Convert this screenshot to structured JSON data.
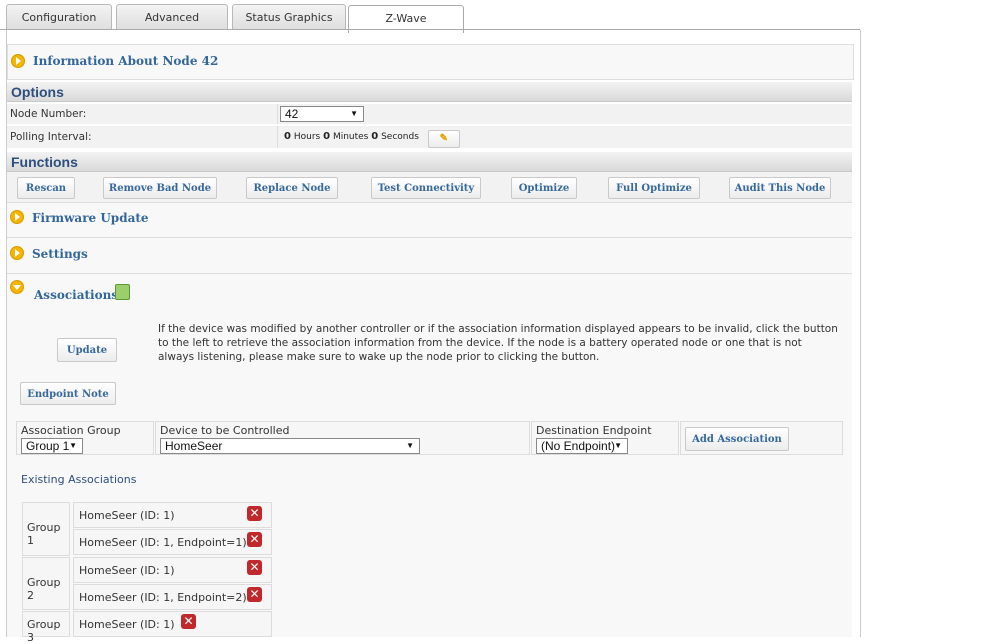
{
  "tabs": [
    {
      "label": "Configuration"
    },
    {
      "label": "Advanced"
    },
    {
      "label": "Status Graphics"
    },
    {
      "label": "Z-Wave"
    }
  ],
  "info": {
    "title": "Information About Node 42"
  },
  "options": {
    "header": "Options",
    "node_number_label": "Node Number:",
    "node_number_value": "42",
    "polling_label": "Polling Interval:",
    "polling": {
      "hours": "0",
      "hours_label": "Hours",
      "minutes": "0",
      "minutes_label": "Minutes",
      "seconds": "0",
      "seconds_label": "Seconds"
    }
  },
  "functions": {
    "header": "Functions",
    "buttons": [
      "Rescan",
      "Remove Bad Node",
      "Replace Node",
      "Test Connectivity",
      "Optimize",
      "Full Optimize",
      "Audit This Node"
    ]
  },
  "sections": {
    "firmware": "Firmware Update",
    "settings": "Settings",
    "associations": "Associations"
  },
  "associations": {
    "update_button": "Update",
    "description": "If the device was modified by another controller or if the association information displayed appears to be invalid, click the button to the left to retrieve the association information from the device. If the node is a battery operated node or one that is not always listening, please make sure to wake up the node prior to clicking the button.",
    "endpoint_note_button": "Endpoint Note",
    "group_label": "Association Group",
    "group_value": "Group 1",
    "device_label": "Device to be Controlled",
    "device_value": "HomeSeer",
    "endpoint_label": "Destination Endpoint",
    "endpoint_value": "(No Endpoint)",
    "add_button": "Add Association",
    "existing_title": "Existing Associations",
    "existing": [
      {
        "group": "Group 1",
        "entries": [
          "HomeSeer (ID: 1)",
          "HomeSeer (ID: 1, Endpoint=1)"
        ]
      },
      {
        "group": "Group 2",
        "entries": [
          "HomeSeer (ID: 1)",
          "HomeSeer (ID: 1, Endpoint=2)"
        ]
      },
      {
        "group": "Group 3",
        "entries": [
          "HomeSeer (ID: 1)"
        ]
      }
    ]
  },
  "colors": {
    "accent": "#33669a",
    "bullet": "#f4b400",
    "delete": "#c0282b"
  }
}
